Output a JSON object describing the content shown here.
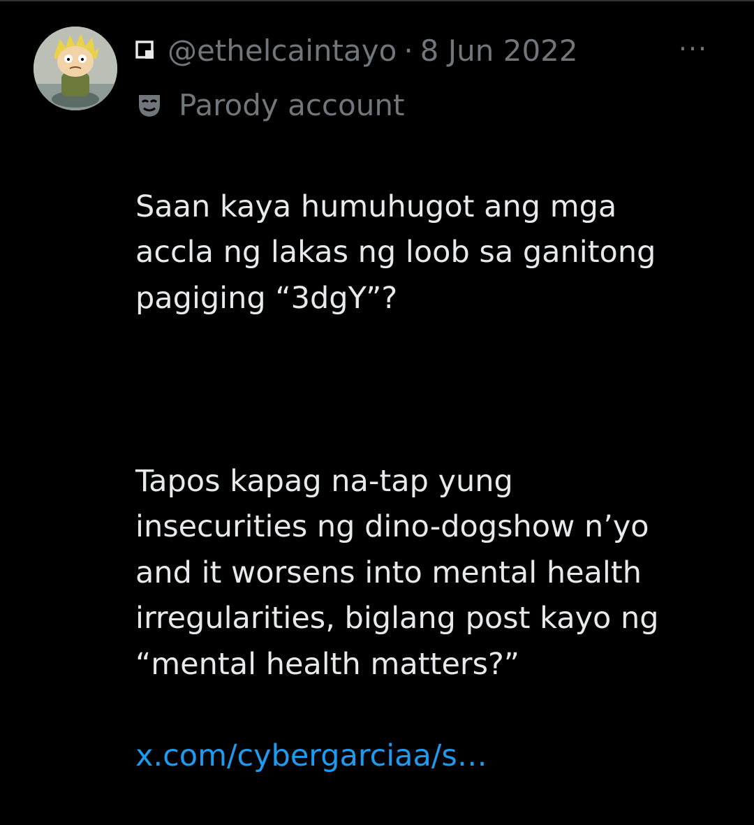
{
  "author": {
    "handle": "@ethelcaintayo",
    "separator": "·",
    "date": "8 Jun 2022",
    "label": "Parody account"
  },
  "more_label": "···",
  "tweet": {
    "paragraph_1": "Saan kaya humuhugot ang mga\naccla ng lakas ng loob sa ganitong\npagiging “3dgY”?",
    "paragraph_2": "Tapos kapag na-tap yung\ninsecurities ng dino-dogshow n’yo\nand it worsens into mental health\nirregularities, biglang post kayo ng\n“mental health matters?”",
    "link": "x.com/cybergarciaa/s…"
  },
  "icons": {
    "avatar": "cartoon-avatar",
    "square": "square-icon",
    "mask": "parody-mask-icon"
  },
  "colors": {
    "background": "#000000",
    "text": "#e7e9ea",
    "secondary": "#71767b",
    "link": "#1d9bf0"
  }
}
